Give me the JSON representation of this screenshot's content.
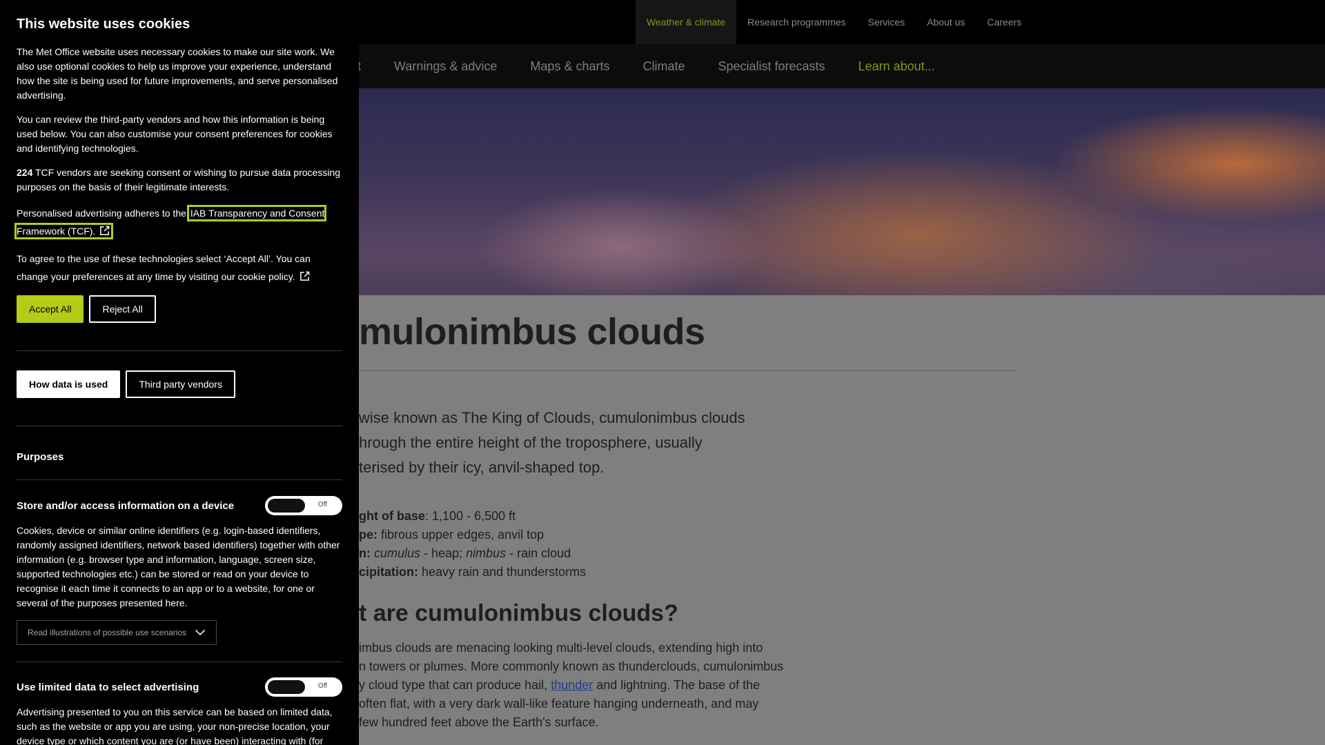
{
  "topnav": {
    "items": [
      "Weather & climate",
      "Research programmes",
      "Services",
      "About us",
      "Careers"
    ],
    "active_index": 0
  },
  "mainnav": {
    "items": [
      "cast",
      "Warnings & advice",
      "Maps & charts",
      "Climate",
      "Specialist forecasts",
      "Learn about..."
    ],
    "settings_icon": "gear-icon",
    "search_icon": "search-icon"
  },
  "article": {
    "title": "mulonimbus clouds",
    "lede": "wise known as The King of Clouds, cumulonimbus clouds hrough the entire height of the troposphere, usually terised by their icy, anvil-shaped top.",
    "lede_lines": [
      "wise known as The King of Clouds, cumulonimbus clouds",
      "hrough the entire height of the troposphere, usually",
      "terised by their icy, anvil-shaped top."
    ],
    "facts": [
      {
        "label": "ght of base",
        "sep": ": ",
        "value": "1,100 - 6,500 ft"
      },
      {
        "label": "pe:",
        "sep": " ",
        "value": "fibrous upper edges, anvil top"
      },
      {
        "label": "n:",
        "sep": " ",
        "value_parts": [
          "cumulus",
          " - heap; ",
          "nimbus",
          " - rain cloud"
        ]
      },
      {
        "label": "cipitation:",
        "sep": " ",
        "value": "heavy rain and thunderstorms"
      }
    ],
    "h2": "t are cumulonimbus clouds?",
    "body_lines": [
      "imbus clouds are menacing looking multi-level clouds, extending high into",
      "n towers or plumes. More commonly known as thunderclouds, cumulonimbus",
      "y cloud type that can produce hail, ",
      " and lightning. The base of the",
      "often flat, with a very dark wall-like feature hanging underneath, and may",
      "few hundred feet above the Earth's surface."
    ],
    "body_link": "thunder"
  },
  "cookie": {
    "title": "This website uses cookies",
    "p1": "The Met Office website uses necessary cookies to make our site work. We also use optional cookies to help us improve your experience, understand how the site is being used for future improvements, and serve personalised advertising.",
    "p2": "You can review the third-party vendors and how this information is being used below. You can also customise your consent preferences for cookies and identifying technologies.",
    "vendor_count": "224",
    "p3_rest": " TCF vendors are seeking consent or wishing to pursue data processing purposes on the basis of their legitimate interests.",
    "p4_prefix": "Personalised advertising adheres to the ",
    "p4_link": "IAB Transparency and Consent Framework (TCF).",
    "p5": "To agree to the use of these technologies select ‘Accept All’. You can change your preferences at any time by visiting our cookie policy.",
    "accept_label": "Accept All",
    "reject_label": "Reject All",
    "how_data_label": "How data is used",
    "vendors_label": "Third party vendors",
    "purposes_heading": "Purposes",
    "purpose1": {
      "title": "Store and/or access information on a device",
      "toggle": "Off",
      "desc": "Cookies, device or similar online identifiers (e.g. login-based identifiers, randomly assigned identifiers, network based identifiers) together with other information (e.g. browser type and information, language, screen size, supported technologies etc.) can be stored or read on your device to recognise it each time it connects to an app or to a website, for one or several of the purposes presented here.",
      "scenarios": "Read illustrations of possible use scenarios"
    },
    "purpose2": {
      "title": "Use limited data to select advertising",
      "toggle": "Off",
      "desc": "Advertising presented to you on this service can be based on limited data, such as the website or app you are using, your non-precise location, your device type or which content you are (or have been) interacting with (for"
    }
  },
  "colors": {
    "accent": "#b4cc18",
    "nav_active": "#7d9a1a",
    "link": "#1d3e8c",
    "panel_bg": "#000000"
  }
}
